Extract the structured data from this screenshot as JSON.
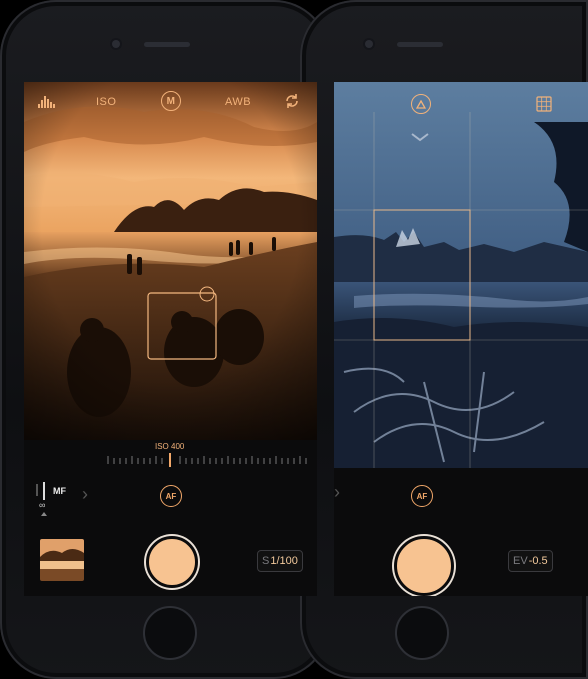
{
  "left_screen": {
    "top_bar": {
      "histogram_icon": "histogram-icon",
      "iso_label": "ISO",
      "mode_badge": "M",
      "wb_label": "AWB",
      "flip_icon": "camera-flip-icon"
    },
    "iso_scale_label": "ISO 400",
    "focus": {
      "mode_label": "MF",
      "infinity_symbol": "∞"
    },
    "af_label": "AF",
    "shutter_speed": {
      "prefix": "S",
      "value": "1/100"
    }
  },
  "right_screen": {
    "top_bar": {
      "mode_icon": "triangle-icon",
      "grid_icon": "grid-icon"
    },
    "af_label": "AF",
    "exposure": {
      "prefix": "EV",
      "value": "-0.5"
    }
  },
  "colors": {
    "accent": "#f2a86a",
    "shutter": "#f7c391",
    "background": "#000000"
  }
}
